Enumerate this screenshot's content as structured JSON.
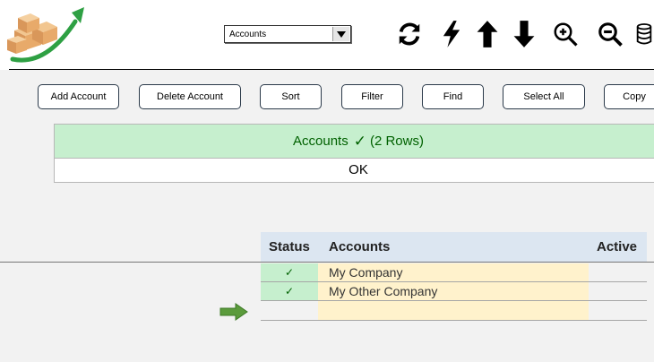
{
  "header": {
    "account_select": {
      "value": "Accounts"
    },
    "tools": [
      "refresh-icon",
      "lightning-icon",
      "arrow-up-icon",
      "arrow-down-icon",
      "zoom-in-icon",
      "zoom-out-icon",
      "database-icon"
    ]
  },
  "toolbar": {
    "add_account": "Add Account",
    "delete_account": "Delete Account",
    "sort": "Sort",
    "filter": "Filter",
    "find": "Find",
    "select_all": "Select All",
    "copy": "Copy"
  },
  "result": {
    "title": "Accounts",
    "check": "✓",
    "rows_text": "(2 Rows)",
    "message": "OK"
  },
  "grid": {
    "columns": [
      "Status",
      "Accounts",
      "Active"
    ],
    "rows": [
      {
        "status": "✓",
        "account": "My Company",
        "active": ""
      },
      {
        "status": "✓",
        "account": "My Other Company",
        "active": ""
      },
      {
        "status": "",
        "account": "",
        "active": ""
      }
    ]
  },
  "colors": {
    "ok_fill": "#c6efce",
    "ok_text": "#006100",
    "account_cell": "#fff2cc",
    "header_fill": "#dce6f1",
    "arrow_green": "#2ea043",
    "row_pointer": "#5b9b3c"
  }
}
